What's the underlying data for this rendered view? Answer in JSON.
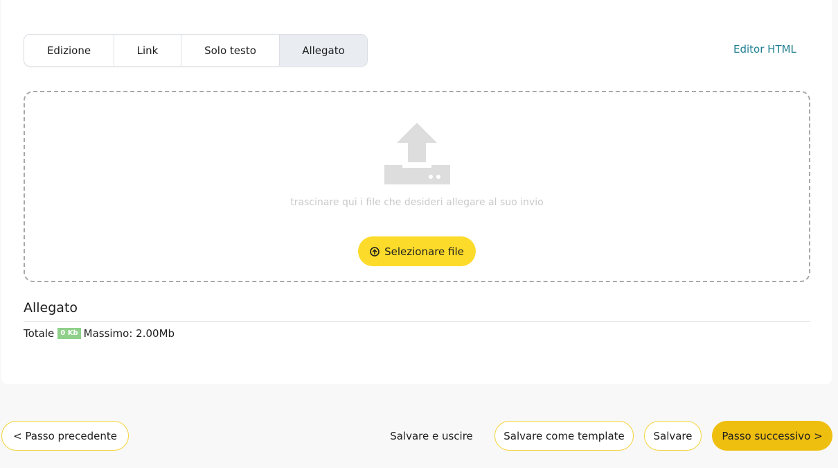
{
  "tabs": [
    {
      "label": "Edizione",
      "active": false
    },
    {
      "label": "Link",
      "active": false
    },
    {
      "label": "Solo testo",
      "active": false
    },
    {
      "label": "Allegato",
      "active": true
    }
  ],
  "editor_link": "Editor HTML",
  "dropzone": {
    "icon": "upload-tray-icon",
    "hint": "trascinare qui i file che desideri allegare al suo invio",
    "select_button": "Selezionare file",
    "select_icon": "upload-circle-icon"
  },
  "attachment": {
    "title": "Allegato",
    "total_label": "Totale",
    "total_value": "0 Kb",
    "max_label": "Massimo: 2.00Mb"
  },
  "footer": {
    "prev": "< Passo precedente",
    "save_exit": "Salvare e uscire",
    "save_template": "Salvare come template",
    "save": "Salvare",
    "next": "Passo successivo >"
  },
  "colors": {
    "accent_yellow": "#fddb2a",
    "primary_yellow": "#efbf10",
    "link_teal": "#1e7f90",
    "badge_green": "#8fd08a"
  }
}
